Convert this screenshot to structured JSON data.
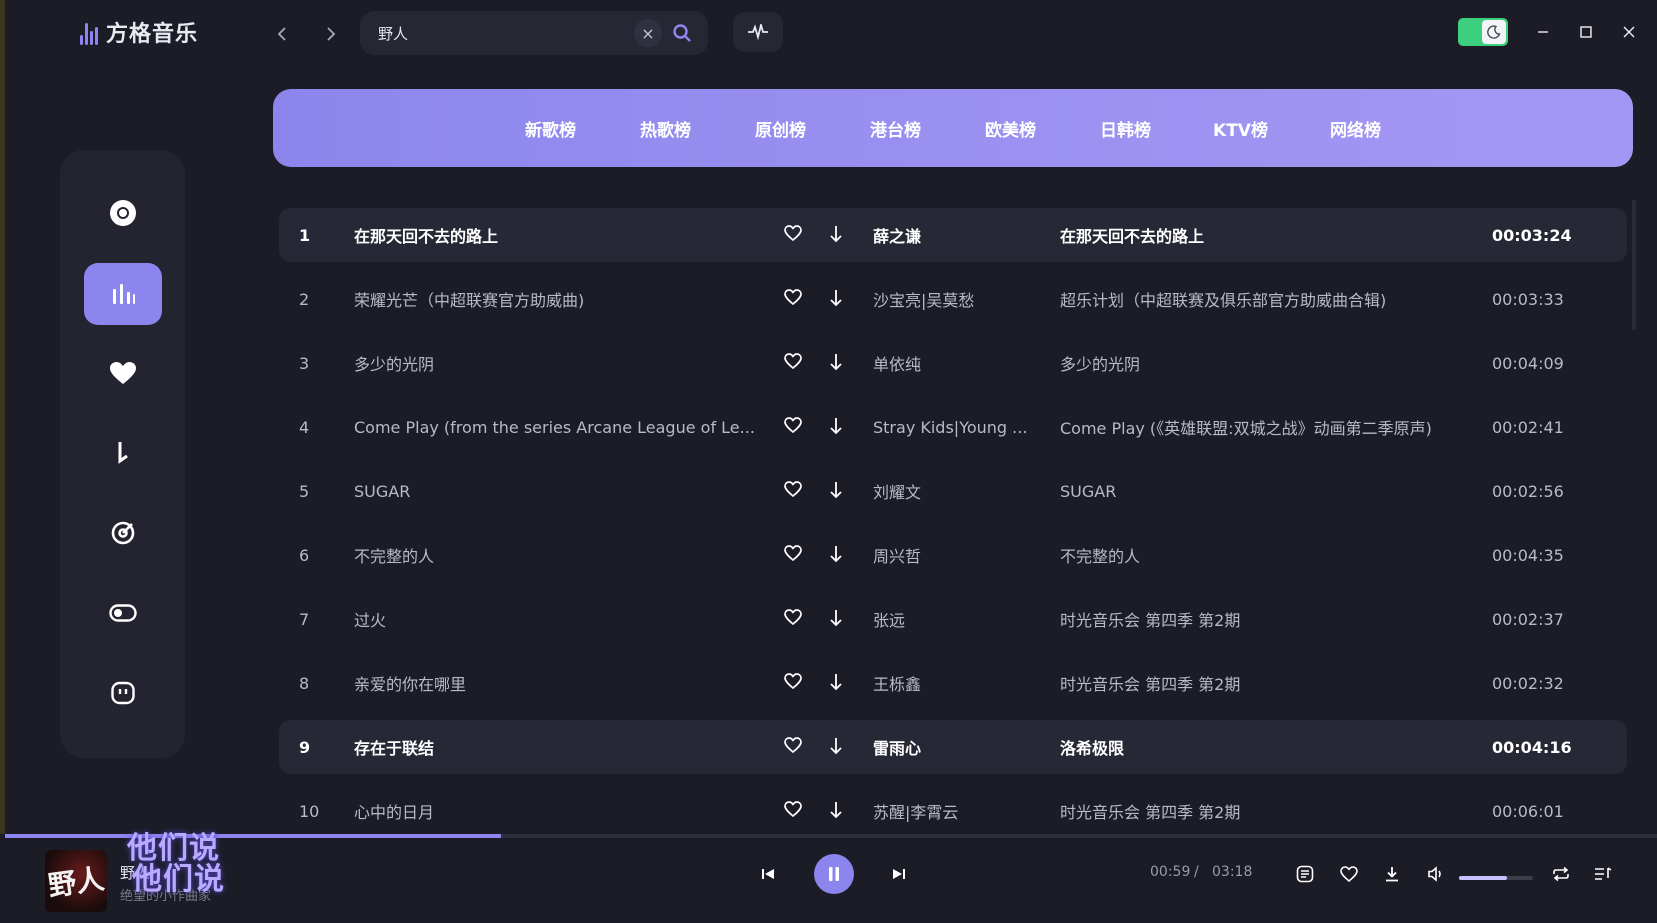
{
  "app": {
    "name": "方格音乐",
    "accent": "#8d85ee",
    "bg": "#1b1c26"
  },
  "search": {
    "value": "野人"
  },
  "window": {
    "minimize": "–",
    "maximize": "☐",
    "close": "✕"
  },
  "categories": [
    "新歌榜",
    "热歌榜",
    "原创榜",
    "港台榜",
    "欧美榜",
    "日韩榜",
    "KTV榜",
    "网络榜"
  ],
  "sidebar": {
    "items": [
      {
        "icon": "disc-icon",
        "active": false
      },
      {
        "icon": "chart-bars-icon",
        "active": true
      },
      {
        "icon": "heart-icon",
        "active": false
      },
      {
        "icon": "music-note-icon",
        "active": false
      },
      {
        "icon": "target-icon",
        "active": false
      },
      {
        "icon": "toggle-icon",
        "active": false
      },
      {
        "icon": "bot-face-icon",
        "active": false
      }
    ]
  },
  "tracks": [
    {
      "num": "1",
      "title": "在那天回不去的路上",
      "artist": "薛之谦",
      "album": "在那天回不去的路上",
      "duration": "00:03:24",
      "highlight": true
    },
    {
      "num": "2",
      "title": "荣耀光芒（中超联赛官方助威曲)",
      "artist": "沙宝亮|吴莫愁",
      "album": "超乐计划（中超联赛及俱乐部官方助威曲合辑)",
      "duration": "00:03:33",
      "highlight": false
    },
    {
      "num": "3",
      "title": "多少的光阴",
      "artist": "单依纯",
      "album": "多少的光阴",
      "duration": "00:04:09",
      "highlight": false
    },
    {
      "num": "4",
      "title": "Come Play (from the series Arcane League of Le...",
      "artist": "Stray Kids|Young ...",
      "album": "Come Play (《英雄联盟:双城之战》动画第二季原声)",
      "duration": "00:02:41",
      "highlight": false
    },
    {
      "num": "5",
      "title": "SUGAR",
      "artist": "刘耀文",
      "album": "SUGAR",
      "duration": "00:02:56",
      "highlight": false
    },
    {
      "num": "6",
      "title": "不完整的人",
      "artist": "周兴哲",
      "album": "不完整的人",
      "duration": "00:04:35",
      "highlight": false
    },
    {
      "num": "7",
      "title": "过火",
      "artist": "张远",
      "album": "时光音乐会 第四季 第2期",
      "duration": "00:02:37",
      "highlight": false
    },
    {
      "num": "8",
      "title": "亲爱的你在哪里",
      "artist": "王栎鑫",
      "album": "时光音乐会 第四季 第2期",
      "duration": "00:02:32",
      "highlight": false
    },
    {
      "num": "9",
      "title": "存在于联结",
      "artist": "雷雨心",
      "album": "洛希极限",
      "duration": "00:04:16",
      "highlight": true
    },
    {
      "num": "10",
      "title": "心中的日月",
      "artist": "苏醒|李霄云",
      "album": "时光音乐会 第四季 第2期",
      "duration": "00:06:01",
      "highlight": false
    }
  ],
  "player": {
    "cover_text": "野人",
    "title": "野人",
    "artist": "绝望的小作曲家",
    "lyric_line_1": "他们说",
    "lyric_line_2": "他们说",
    "current_time": "00:59",
    "separator": "/",
    "total_time": "03:18",
    "progress": 0.3,
    "volume": 0.65
  }
}
